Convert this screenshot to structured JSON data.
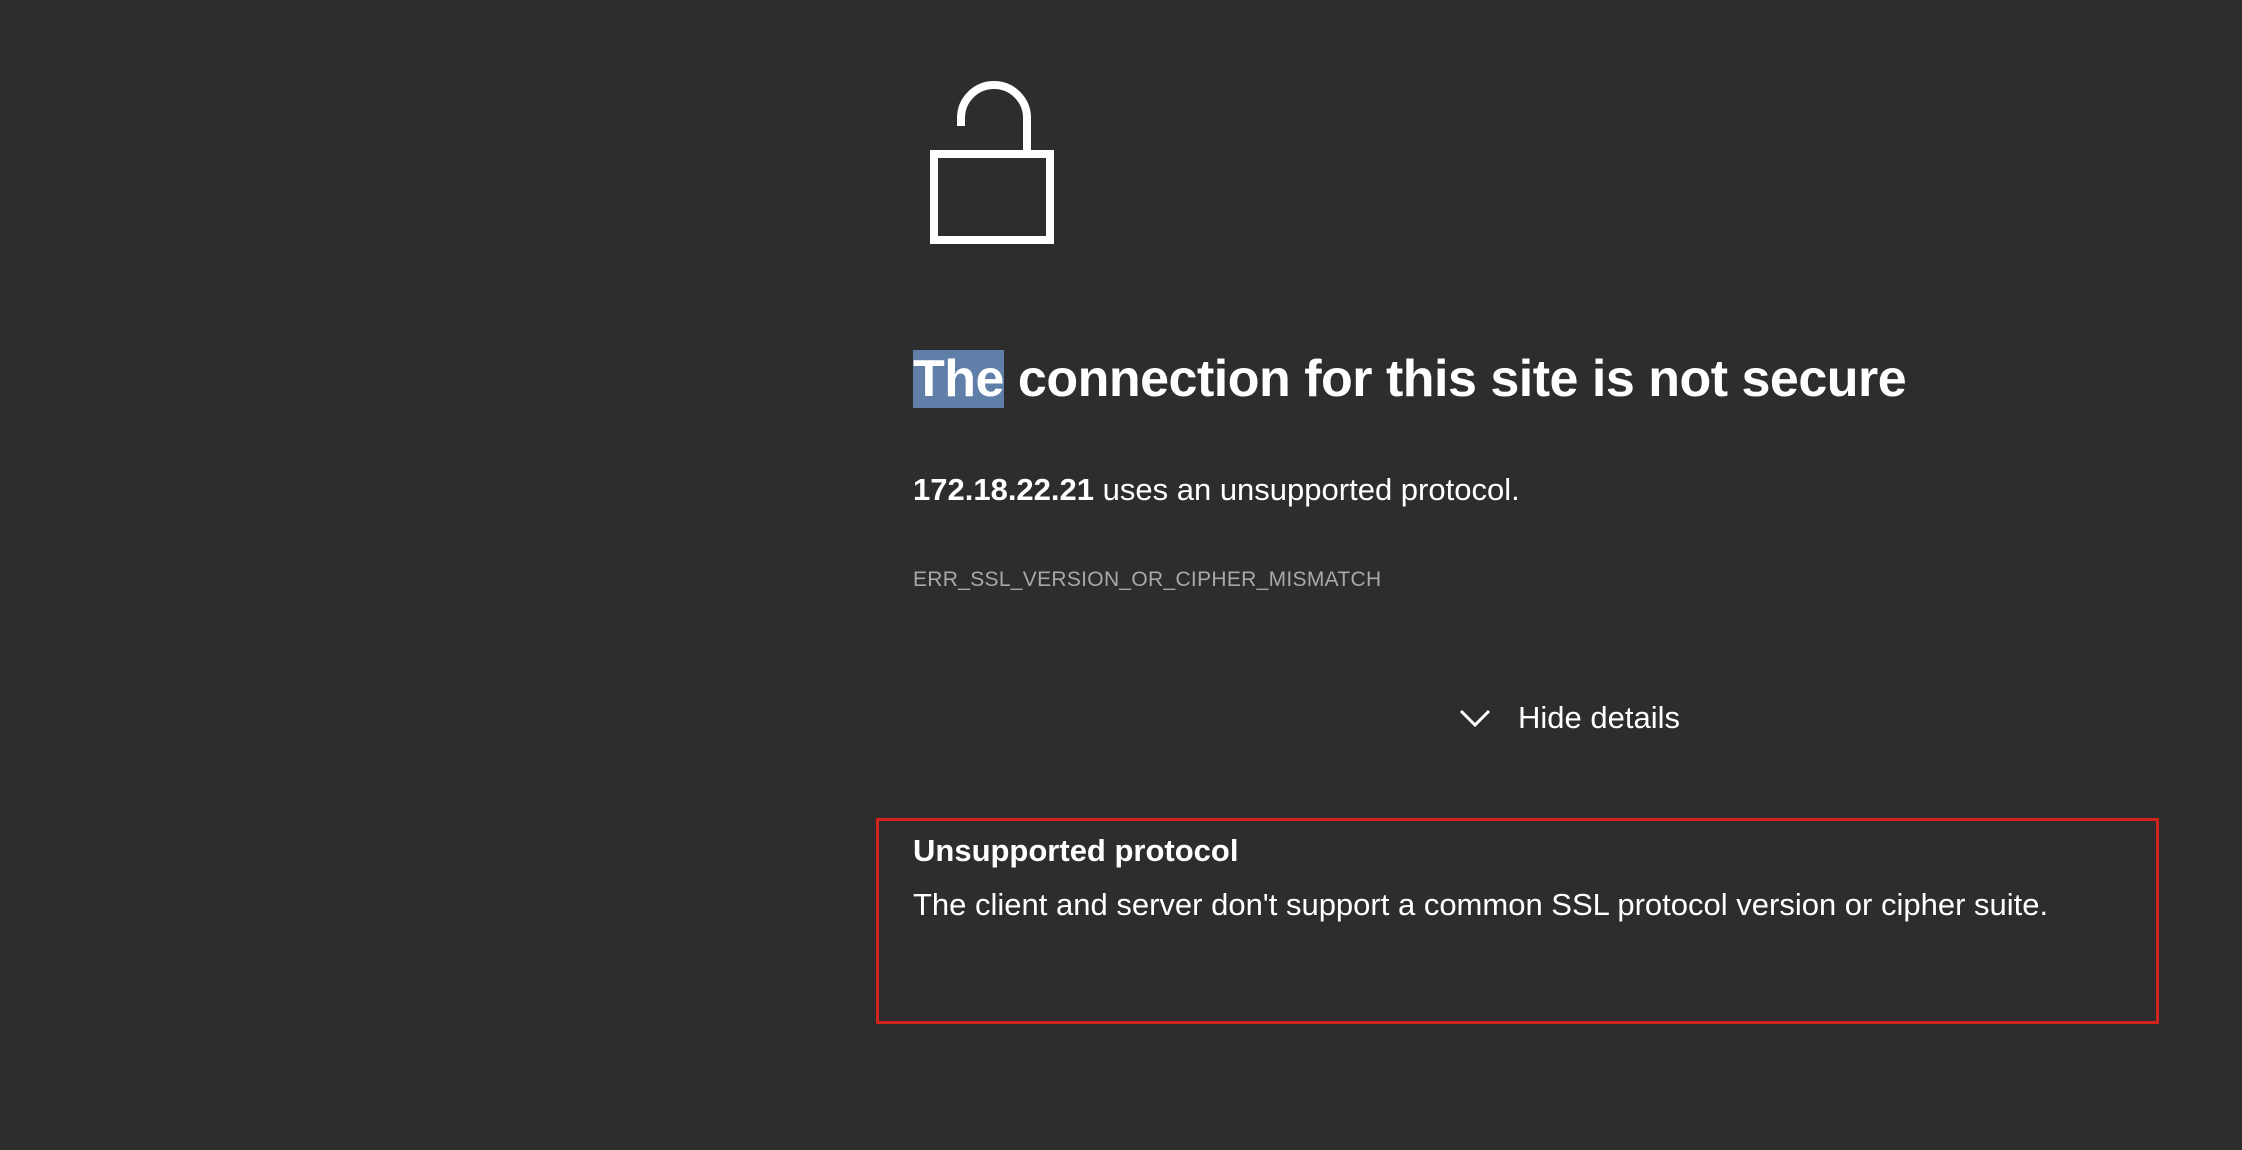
{
  "headline": {
    "selected_word": "The",
    "rest": " connection for this site is not secure"
  },
  "summary": {
    "host": "172.18.22.21",
    "message": " uses an unsupported protocol."
  },
  "error_code": "ERR_SSL_VERSION_OR_CIPHER_MISMATCH",
  "details_toggle": {
    "icon": "chevron-down-icon",
    "label": "Hide details"
  },
  "details": {
    "title": "Unsupported protocol",
    "body": "The client and server don't support a common SSL protocol version or cipher suite."
  },
  "icons": {
    "lock": "unlocked-padlock-icon"
  },
  "colors": {
    "background": "#2d2d2d",
    "text": "#ffffff",
    "muted_text": "#a8a8a8",
    "selection": "#5f7fa8",
    "highlight_box": "#d2241f"
  }
}
